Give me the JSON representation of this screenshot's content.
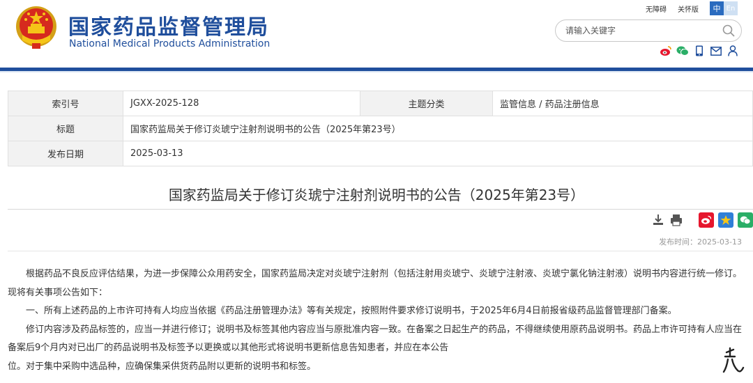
{
  "header": {
    "brand_cn": "国家药品监督管理局",
    "brand_en": "National Medical Products Administration",
    "top_links": {
      "accessibility": "无障碍",
      "elder_mode": "关怀版",
      "lang_zh": "中",
      "lang_en": "En"
    },
    "search": {
      "placeholder": "请输入关键字"
    },
    "social_icons": [
      "weibo-icon",
      "wechat-icon",
      "mobile-icon",
      "mail-icon",
      "user-icon"
    ]
  },
  "info_table": {
    "index_label": "索引号",
    "index_value": "JGXX-2025-128",
    "topic_label": "主题分类",
    "topic_value": "监管信息 / 药品注册信息",
    "title_label": "标题",
    "title_value": "国家药监局关于修订炎琥宁注射剂说明书的公告（2025年第23号）",
    "date_label": "发布日期",
    "date_value": "2025-03-13"
  },
  "article": {
    "title": "国家药监局关于修订炎琥宁注射剂说明书的公告（2025年第23号）",
    "publish_time": "发布时间：2025-03-13",
    "paragraphs": [
      "根据药品不良反应评估结果，为进一步保障公众用药安全，国家药监局决定对炎琥宁注射剂（包括注射用炎琥宁、炎琥宁注射液、炎琥宁氯化钠注射液）说明书内容进行统一修订。现将有关事项公告如下：",
      "一、所有上述药品的上市许可持有人均应当依据《药品注册管理办法》等有关规定，按照附件要求修订说明书，于2025年6月4日前报省级药品监督管理部门备案。",
      "修订内容涉及药品标签的，应当一并进行修订；说明书及标签其他内容应当与原批准内容一致。在备案之日起生产的药品，不得继续使用原药品说明书。药品上市许可持有人应当在备案后9个月内对已出厂的药品说明书及标签予以更换或以其他形式将说明书更新信息告知患者，并应在本公告",
      "位。对于集中采购中选品种，应确保集采供货药品附以更新的说明书和标签。"
    ]
  },
  "colors": {
    "brand_blue": "#1f4e9c",
    "weibo_red": "#e6162d",
    "wechat_green": "#2aae67",
    "favorite_blue": "#2f7fd8"
  }
}
